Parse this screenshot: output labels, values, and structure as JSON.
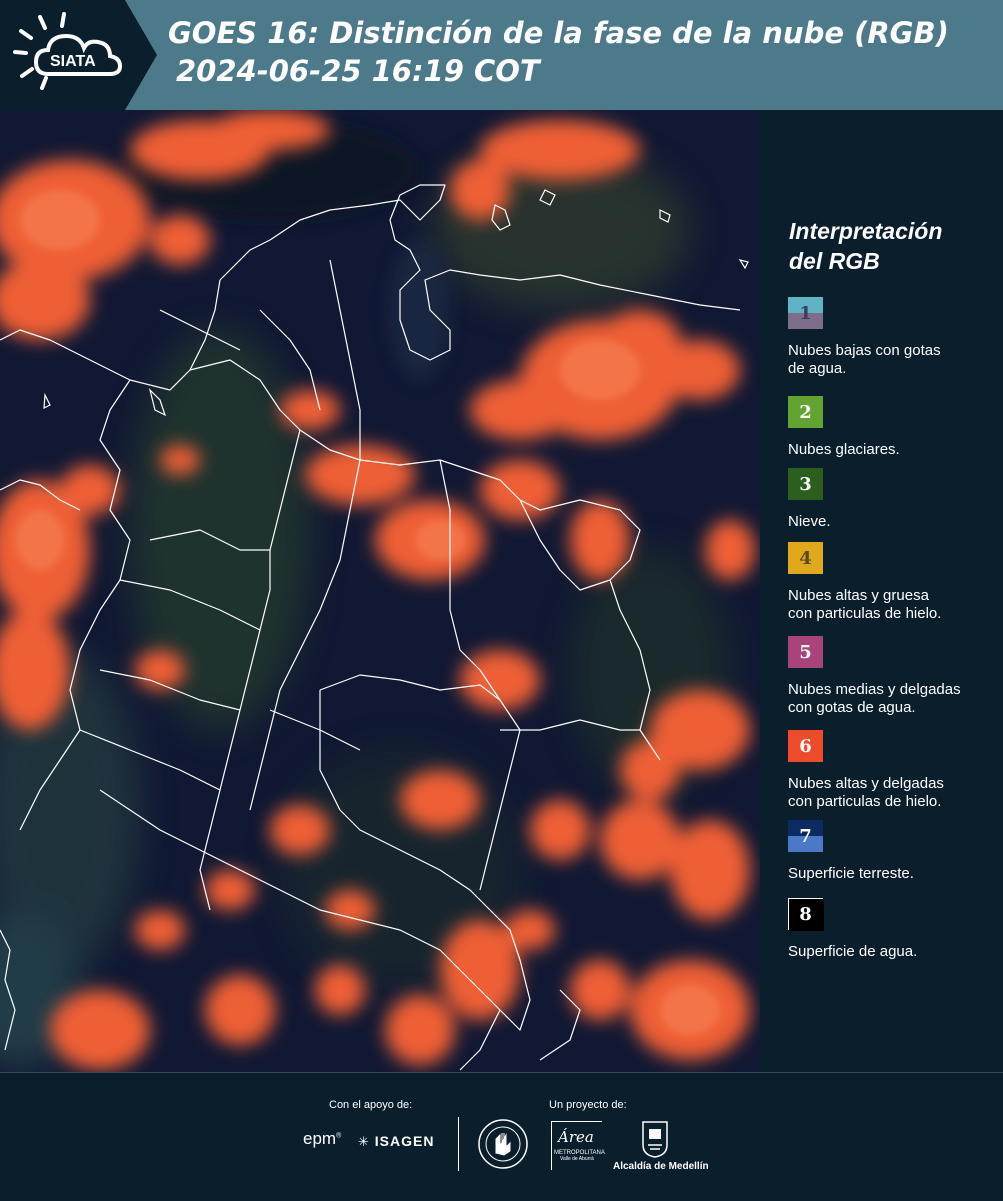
{
  "header": {
    "logo_text": "SIATA",
    "title_line1": "GOES 16: Distinción de la fase de la nube (RGB)",
    "title_line2": "2024-06-25 16:19 COT"
  },
  "legend": {
    "title_line1": "Interpretación",
    "title_line2": "del RGB",
    "items": [
      {
        "number": "1",
        "label_l1": "Nubes bajas con gotas",
        "label_l2": "de agua.",
        "color_top": "#5fb3c4",
        "color_bottom": "#7d6f8c",
        "text_color": "#3d3d55"
      },
      {
        "number": "2",
        "label_l1": "Nubes glaciares.",
        "label_l2": "",
        "color_top": "#63a331",
        "color_bottom": "#63a331",
        "text_color": "#ffffff"
      },
      {
        "number": "3",
        "label_l1": "Nieve.",
        "label_l2": "",
        "color_top": "#2c5e1e",
        "color_bottom": "#2c5e1e",
        "text_color": "#ffffff"
      },
      {
        "number": "4",
        "label_l1": "Nubes altas y gruesa",
        "label_l2": "con particulas de hielo.",
        "color_top": "#e0a91c",
        "color_bottom": "#e0a91c",
        "text_color": "#5a4a20"
      },
      {
        "number": "5",
        "label_l1": "Nubes medias y delgadas",
        "label_l2": "con gotas de agua.",
        "color_top": "#a8437c",
        "color_bottom": "#a8437c",
        "text_color": "#ffffff"
      },
      {
        "number": "6",
        "label_l1": "Nubes altas y delgadas",
        "label_l2": "con particulas de hielo.",
        "color_top": "#ee4a2c",
        "color_bottom": "#ee4a2c",
        "text_color": "#ffffff"
      },
      {
        "number": "7",
        "label_l1": "Superficie terreste.",
        "label_l2": "",
        "color_top": "#0d2b63",
        "color_bottom": "#4c78c8",
        "text_color": "#ffffff"
      },
      {
        "number": "8",
        "label_l1": "Superficie de agua.",
        "label_l2": "",
        "color_top": "#000000",
        "color_bottom": "#000000",
        "text_color": "#ffffff"
      }
    ]
  },
  "footer": {
    "support_label": "Con el apoyo de:",
    "project_label": "Un proyecto de:",
    "sponsor_epm": "epm",
    "sponsor_isagen": "ISAGEN",
    "sponsor_metro": "Área",
    "sponsor_metro_sub": "METROPOLITANA",
    "sponsor_metro_sub2": "Valle de Aburrá",
    "sponsor_alcaldia": "Alcaldía de Medellín"
  },
  "colors": {
    "header_bg": "#4d7a8a",
    "panel_bg": "#0b1e2b",
    "cloud_orange": "#f0623a",
    "land_dark": "#121a33"
  }
}
